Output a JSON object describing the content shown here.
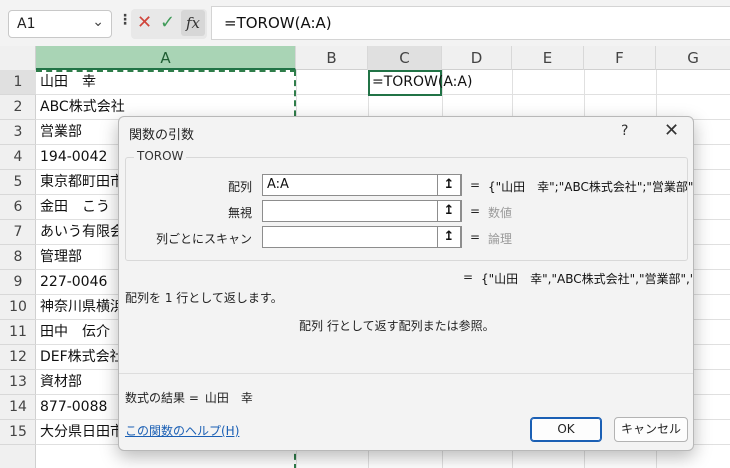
{
  "name_box": {
    "value": "A1",
    "arrow": "⌄"
  },
  "formula_bar": {
    "dots": "⋮",
    "cancel_glyph": "✕",
    "enter_glyph": "✓",
    "fx_glyph": "fx",
    "formula": "=TOROW(A:A)"
  },
  "columns": [
    "A",
    "B",
    "C",
    "D",
    "E",
    "F",
    "G"
  ],
  "rows": [
    "1",
    "2",
    "3",
    "4",
    "5",
    "6",
    "7",
    "8",
    "9",
    "10",
    "11",
    "12",
    "13",
    "14",
    "15"
  ],
  "column_a": [
    "山田　幸",
    "ABC株式会社",
    "営業部",
    "194-0042",
    "東京都町田市",
    "金田　こう",
    "あいう有限会",
    "管理部",
    "227-0046",
    "神奈川県横浜",
    "田中　伝介",
    "DEF株式会社",
    "資材部",
    "877-0088",
    "大分県日田市"
  ],
  "cell_c1": "=TOROW(A:A)",
  "dialog": {
    "title": "関数の引数",
    "help": "?",
    "close": "✕",
    "function_name": "TOROW",
    "args": [
      {
        "label": "配列",
        "value": "A:A",
        "result": "{\"山田　幸\";\"ABC株式会社\";\"営業部\"",
        "button": "↥"
      },
      {
        "label": "無視",
        "value": "",
        "result": "数値",
        "button": "↥"
      },
      {
        "label": "列ごとにスキャン",
        "value": "",
        "result": "論理",
        "button": "↥"
      }
    ],
    "equals": "=",
    "overall_result": "{\"山田　幸\",\"ABC株式会社\",\"営業部\",'",
    "description": "配列を 1 行として返します。",
    "arg_desc_name": "配列",
    "arg_desc_text": "行として返す配列または参照。",
    "result_label": "数式の結果 =",
    "result_value": "山田　幸",
    "help_link": "この関数のヘルプ(H)",
    "ok": "OK",
    "cancel": "キャンセル"
  }
}
